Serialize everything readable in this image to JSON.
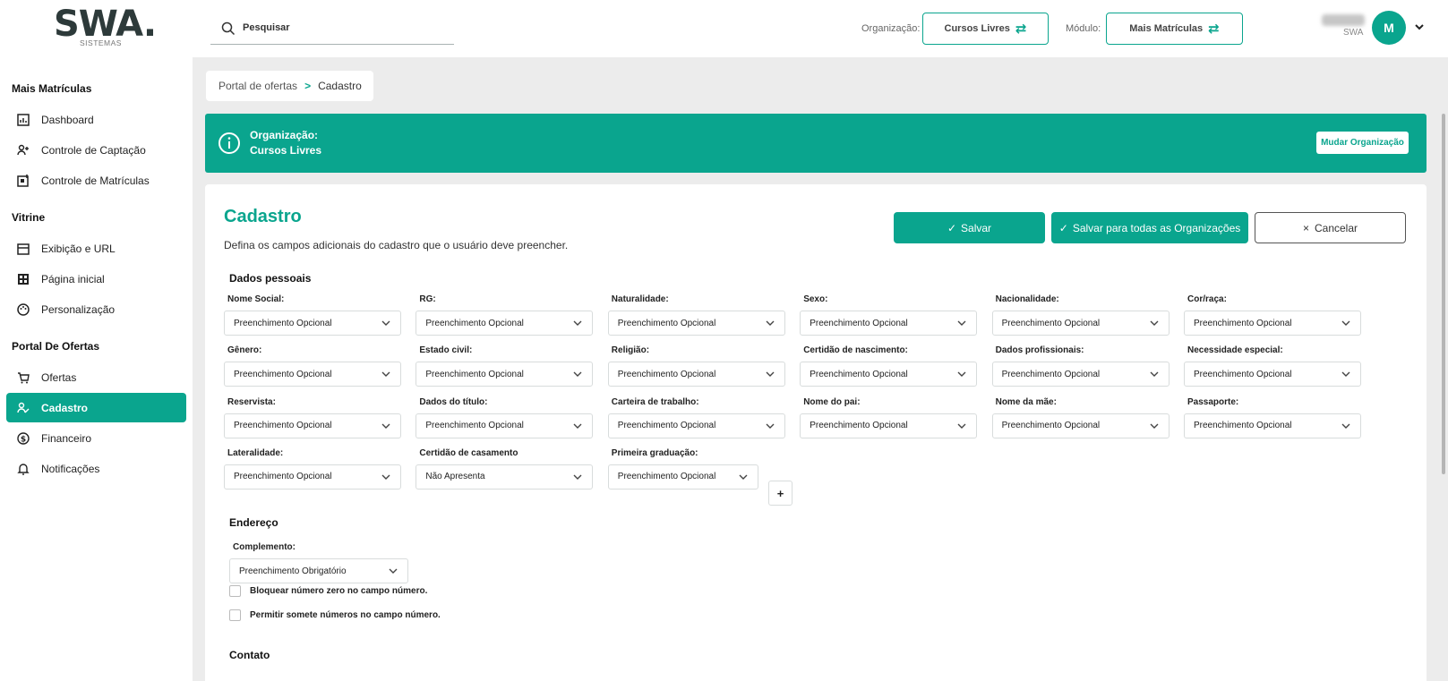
{
  "header": {
    "logo_main": "SWA.",
    "logo_sub": "SISTEMAS",
    "search_placeholder": "Pesquisar",
    "org_label": "Organização:",
    "org_value": "Cursos Livres",
    "module_label": "Módulo:",
    "module_value": "Mais Matrículas",
    "user_org": "SWA",
    "avatar_initial": "M"
  },
  "sidebar": {
    "sections": [
      {
        "title": "Mais Matrículas",
        "items": [
          {
            "label": "Dashboard",
            "icon": "chart-box-icon"
          },
          {
            "label": "Controle de Captação",
            "icon": "user-plus-icon"
          },
          {
            "label": "Controle de Matrículas",
            "icon": "calendar-check-icon"
          }
        ]
      },
      {
        "title": "Vitrine",
        "items": [
          {
            "label": "Exibição e URL",
            "icon": "storefront-icon"
          },
          {
            "label": "Página inicial",
            "icon": "grid-icon"
          },
          {
            "label": "Personalização",
            "icon": "palette-icon"
          }
        ]
      },
      {
        "title": "Portal De Ofertas",
        "items": [
          {
            "label": "Ofertas",
            "icon": "cart-icon"
          },
          {
            "label": "Cadastro",
            "icon": "user-edit-icon",
            "active": true
          },
          {
            "label": "Financeiro",
            "icon": "dollar-circle-icon"
          },
          {
            "label": "Notificações",
            "icon": "bell-icon"
          }
        ]
      }
    ]
  },
  "breadcrumb": {
    "parent": "Portal de ofertas",
    "separator": ">",
    "current": "Cadastro"
  },
  "banner": {
    "title": "Organização:",
    "value": "Cursos Livres",
    "button": "Mudar Organização"
  },
  "card": {
    "title": "Cadastro",
    "subtitle": "Defina os campos adicionais do cadastro que o usuário deve preencher.",
    "save_label": "Salvar",
    "save_all_label": "Salvar para todas as Organizações",
    "cancel_label": "Cancelar"
  },
  "personal": {
    "title": "Dados pessoais",
    "fields": [
      {
        "label": "Nome Social:",
        "value": "Preenchimento Opcional"
      },
      {
        "label": "RG:",
        "value": "Preenchimento Opcional"
      },
      {
        "label": "Naturalidade:",
        "value": "Preenchimento Opcional"
      },
      {
        "label": "Sexo:",
        "value": "Preenchimento Opcional"
      },
      {
        "label": "Nacionalidade:",
        "value": "Preenchimento Opcional"
      },
      {
        "label": "Cor/raça:",
        "value": "Preenchimento Opcional"
      },
      {
        "label": "Gênero:",
        "value": "Preenchimento Opcional"
      },
      {
        "label": "Estado civil:",
        "value": "Preenchimento Opcional"
      },
      {
        "label": "Religião:",
        "value": "Preenchimento Opcional"
      },
      {
        "label": "Certidão de nascimento:",
        "value": "Preenchimento Opcional"
      },
      {
        "label": "Dados profissionais:",
        "value": "Preenchimento Opcional"
      },
      {
        "label": "Necessidade especial:",
        "value": "Preenchimento Opcional"
      },
      {
        "label": "Reservista:",
        "value": "Preenchimento Opcional"
      },
      {
        "label": "Dados do título:",
        "value": "Preenchimento Opcional"
      },
      {
        "label": "Carteira de trabalho:",
        "value": "Preenchimento Opcional"
      },
      {
        "label": "Nome do pai:",
        "value": "Preenchimento Opcional"
      },
      {
        "label": "Nome da mãe:",
        "value": "Preenchimento Opcional"
      },
      {
        "label": "Passaporte:",
        "value": "Preenchimento Opcional"
      },
      {
        "label": "Lateralidade:",
        "value": "Preenchimento Opcional"
      },
      {
        "label": "Certidão de casamento",
        "value": "Não Apresenta"
      },
      {
        "label": "Primeira graduação:",
        "value": "Preenchimento Opcional"
      }
    ],
    "add_button": "+"
  },
  "address": {
    "title": "Endereço",
    "complement_label": "Complemento:",
    "complement_value": "Preenchimento Obrigatório",
    "check1": "Bloquear número zero no campo número.",
    "check2": "Permitir somete números no campo número."
  },
  "contact": {
    "title": "Contato"
  },
  "colors": {
    "accent": "#0aa58e"
  }
}
